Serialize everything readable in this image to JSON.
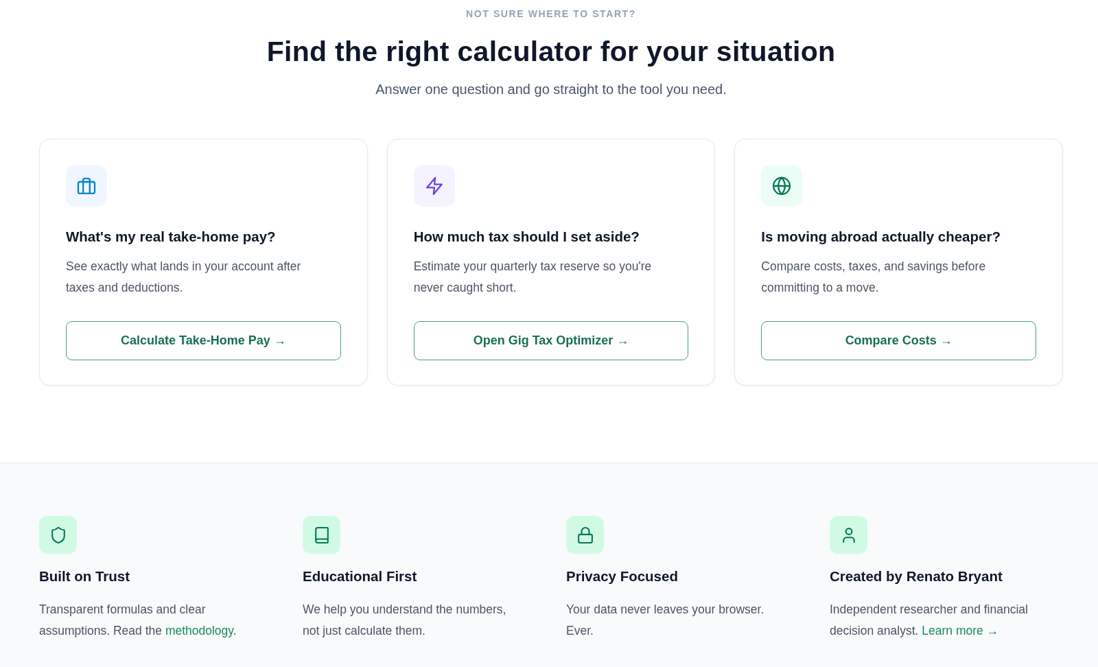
{
  "header": {
    "eyebrow": "NOT SURE WHERE TO START?",
    "title": "Find the right calculator for your situation",
    "subtitle": "Answer one question and go straight to the tool you need."
  },
  "cards": [
    {
      "title": "What's my real take-home pay?",
      "description": "See exactly what lands in your account after taxes and deductions.",
      "button": "Calculate Take-Home Pay →"
    },
    {
      "title": "How much tax should I set aside?",
      "description": "Estimate your quarterly tax reserve so you're never caught short.",
      "button": "Open Gig Tax Optimizer →"
    },
    {
      "title": "Is moving abroad actually cheaper?",
      "description": "Compare costs, taxes, and savings before committing to a move.",
      "button": "Compare Costs →"
    }
  ],
  "features": [
    {
      "title": "Built on Trust",
      "text": "Transparent formulas and clear assumptions. Read the",
      "link": "methodology",
      "text_after": "."
    },
    {
      "title": "Educational First",
      "text": "We help you understand the numbers, not just calculate them."
    },
    {
      "title": "Privacy Focused",
      "text": "Your data never leaves your browser. Ever."
    },
    {
      "title": "Created by Renato Bryant",
      "text": "Independent researcher and financial decision analyst.",
      "link": "Learn more →"
    }
  ]
}
